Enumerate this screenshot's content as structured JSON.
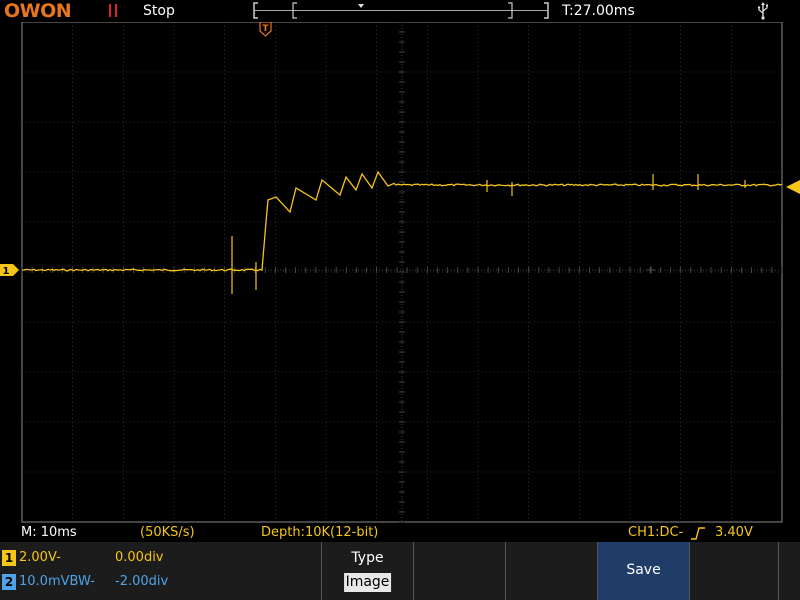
{
  "header": {
    "logo": "OWON",
    "run_status": "Stop",
    "trigger_time": "T:27.00ms"
  },
  "status_bar": {
    "timebase": "M: 10ms",
    "sample_rate": "(50KS/s)",
    "depth": "Depth:10K(12-bit)",
    "trigger": "CH1:DC-",
    "trigger_level": "3.40V"
  },
  "channels": [
    {
      "badge": "1",
      "scale": "2.00V-",
      "position": "0.00div",
      "color": "#f5c518"
    },
    {
      "badge": "2",
      "scale": "10.0mVBW-",
      "position": "-2.00div",
      "color": "#4fa3e8"
    }
  ],
  "menu": {
    "type_title": "Type",
    "type_value": "Image",
    "save_label": "Save"
  },
  "colors": {
    "trace": "#f5c518",
    "accent": "#e8761c",
    "grid": "#5a5a5a",
    "save_button": "#1f3d68"
  }
}
